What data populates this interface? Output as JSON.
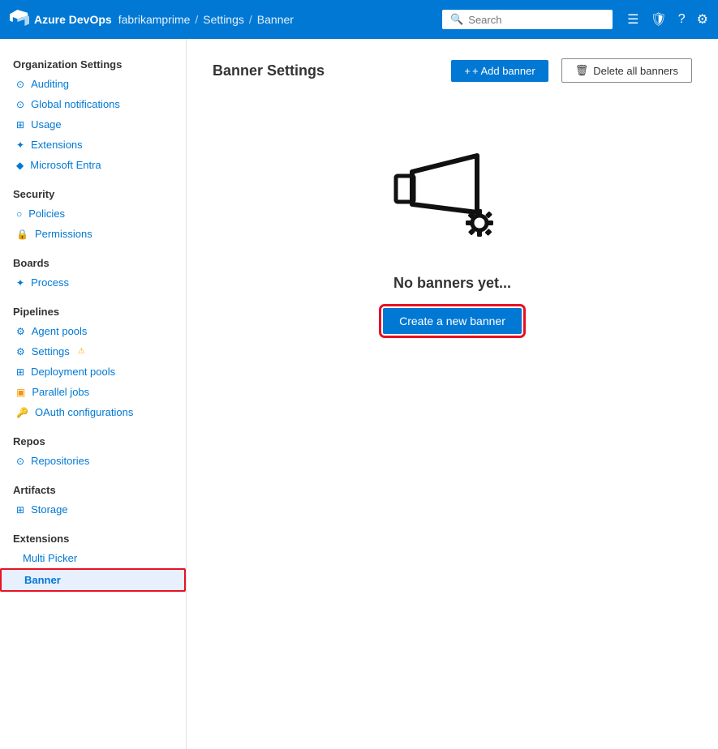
{
  "topnav": {
    "logo_text": "Azure DevOps",
    "breadcrumb": {
      "org": "fabrikamprime",
      "sep1": "/",
      "section": "Settings",
      "sep2": "/",
      "page": "Banner"
    },
    "search_placeholder": "Search",
    "icons": [
      "list-icon",
      "shield-icon",
      "help-icon",
      "user-icon"
    ]
  },
  "sidebar": {
    "org_settings_label": "Organization Settings",
    "items": [
      {
        "id": "auditing",
        "label": "Auditing",
        "icon": "⊙",
        "section": null
      },
      {
        "id": "global-notifications",
        "label": "Global notifications",
        "icon": "⊙",
        "section": null
      },
      {
        "id": "usage",
        "label": "Usage",
        "icon": "⊞",
        "section": null
      },
      {
        "id": "extensions",
        "label": "Extensions",
        "icon": "✦",
        "section": null
      },
      {
        "id": "microsoft-entra",
        "label": "Microsoft Entra",
        "icon": "◆",
        "section": null
      },
      {
        "id": "security-section",
        "label": "Security",
        "section": "Security"
      },
      {
        "id": "policies",
        "label": "Policies",
        "icon": "○",
        "section": null
      },
      {
        "id": "permissions",
        "label": "Permissions",
        "icon": "🔒",
        "section": null
      },
      {
        "id": "boards-section",
        "label": "Boards",
        "section": "Boards"
      },
      {
        "id": "process",
        "label": "Process",
        "icon": "✦",
        "section": null
      },
      {
        "id": "pipelines-section",
        "label": "Pipelines",
        "section": "Pipelines"
      },
      {
        "id": "agent-pools",
        "label": "Agent pools",
        "icon": "⚙",
        "section": null
      },
      {
        "id": "settings",
        "label": "Settings",
        "icon": "⚙",
        "section": null
      },
      {
        "id": "deployment-pools",
        "label": "Deployment pools",
        "icon": "⊞",
        "section": null
      },
      {
        "id": "parallel-jobs",
        "label": "Parallel jobs",
        "icon": "▣",
        "section": null
      },
      {
        "id": "oauth-configurations",
        "label": "OAuth configurations",
        "icon": "🔑",
        "section": null
      },
      {
        "id": "repos-section",
        "label": "Repos",
        "section": "Repos"
      },
      {
        "id": "repositories",
        "label": "Repositories",
        "icon": "⊙",
        "section": null
      },
      {
        "id": "artifacts-section",
        "label": "Artifacts",
        "section": "Artifacts"
      },
      {
        "id": "storage",
        "label": "Storage",
        "icon": "⊞",
        "section": null
      },
      {
        "id": "extensions-section",
        "label": "Extensions",
        "section": "Extensions"
      },
      {
        "id": "multi-picker",
        "label": "Multi Picker",
        "section": null,
        "icon": ""
      },
      {
        "id": "banner",
        "label": "Banner",
        "section": null,
        "icon": "",
        "active": true
      }
    ]
  },
  "main": {
    "title": "Banner Settings",
    "add_banner_label": "+ Add banner",
    "delete_all_label": "Delete all banners",
    "empty_title": "No banners yet...",
    "create_banner_label": "Create a new banner"
  }
}
